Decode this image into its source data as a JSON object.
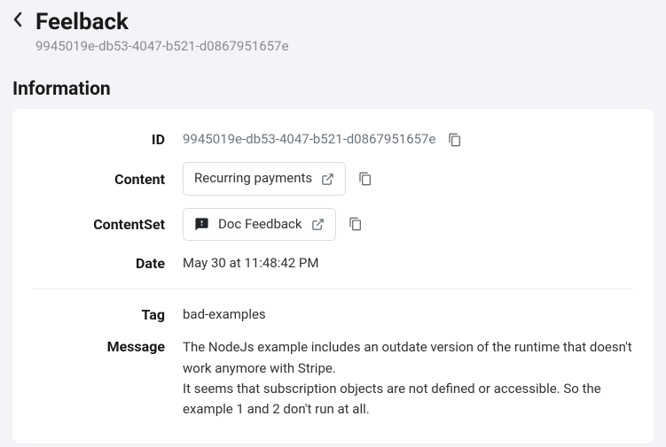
{
  "header": {
    "title": "Feelback",
    "subtitle": "9945019e-db53-4047-b521-d0867951657e"
  },
  "section_title": "Information",
  "labels": {
    "id": "ID",
    "content": "Content",
    "contentset": "ContentSet",
    "date": "Date",
    "tag": "Tag",
    "message": "Message"
  },
  "values": {
    "id": "9945019e-db53-4047-b521-d0867951657e",
    "content": "Recurring payments",
    "contentset": "Doc Feedback",
    "date": "May 30 at 11:48:42 PM",
    "tag": "bad-examples",
    "message": "The NodeJs example includes an outdate version of the runtime that doesn't work anymore with Stripe.\nIt seems that subscription objects are not defined or accessible. So the example 1 and 2 don't run at all."
  }
}
